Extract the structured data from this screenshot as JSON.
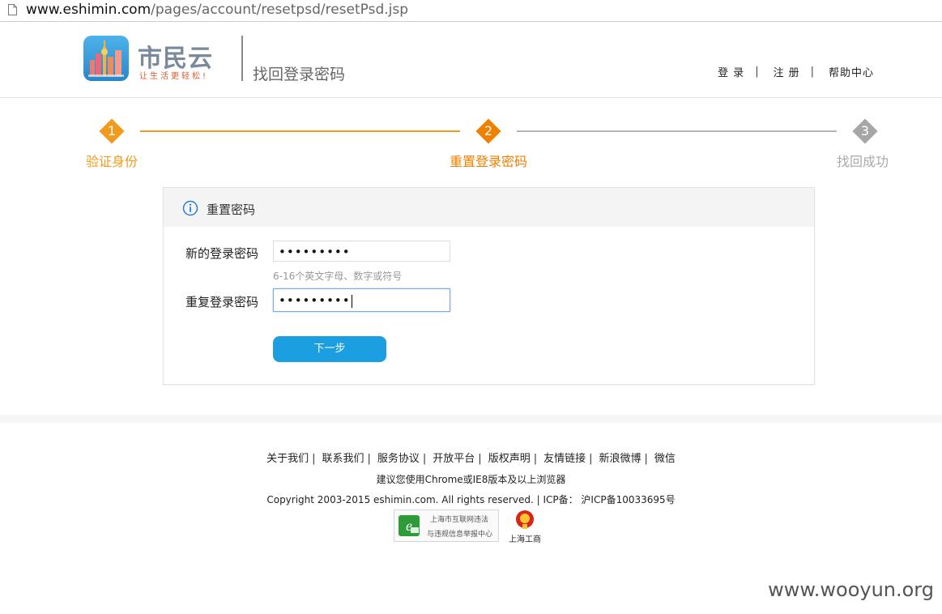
{
  "browser": {
    "url_host": "www.eshimin.com",
    "url_path": "/pages/account/resetpsd/resetPsd.jsp"
  },
  "header": {
    "logo_name": "市民云",
    "logo_slogan": "让生活更轻松!",
    "page_title": "找回登录密码",
    "nav": {
      "login": "登录",
      "register": "注册",
      "help": "帮助中心",
      "separator": "|"
    }
  },
  "steps": [
    {
      "number": "1",
      "label": "验证身份",
      "state": "done",
      "color": "#f29a1b"
    },
    {
      "number": "2",
      "label": "重置登录密码",
      "state": "active",
      "color": "#f08000"
    },
    {
      "number": "3",
      "label": "找回成功",
      "state": "pending",
      "color": "#a6a6a6"
    }
  ],
  "form": {
    "title": "重置密码",
    "new_password_label": "新的登录密码",
    "new_password_value": "•••••••••",
    "hint": "6-16个英文字母、数字或符号",
    "repeat_password_label": "重复登录密码",
    "repeat_password_value": "•••••••••",
    "next_button": "下一步",
    "button_color": "#1b9fe0"
  },
  "footer": {
    "links": [
      "关于我们",
      "联系我们",
      "服务协议",
      "开放平台",
      "版权声明",
      "友情链接",
      "新浪微博",
      "微信"
    ],
    "separator": "|",
    "browser_tip": "建议您使用Chrome或IE8版本及以上浏览器",
    "copyright": "Copyright 2003-2015 eshimin.com. All rights reserved. | ICP备： 沪ICP备10033695号",
    "report_badge_line1": "上海市互联网违法",
    "report_badge_line2": "与违规信息举报中心",
    "aic_badge": "上海工商"
  },
  "watermark": "www.wooyun.org"
}
